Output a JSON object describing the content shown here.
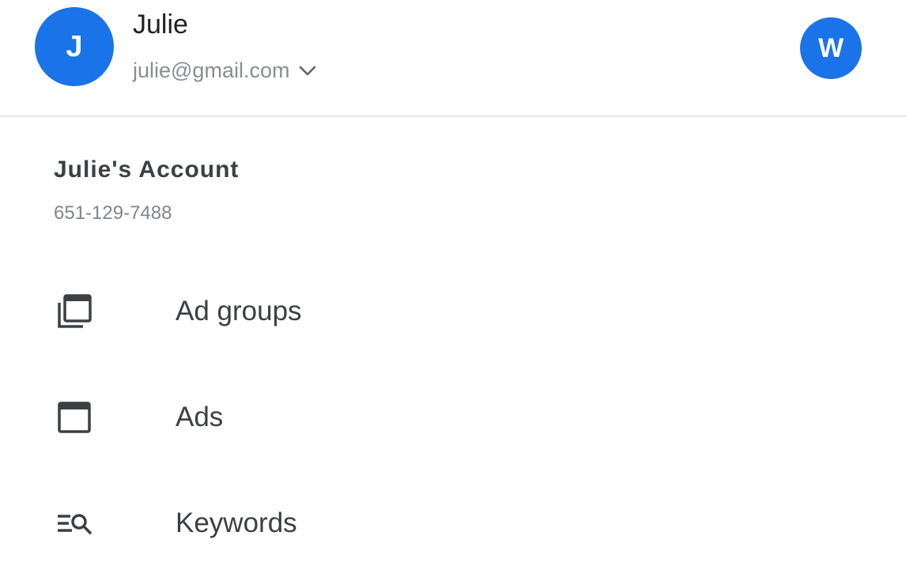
{
  "header": {
    "user_initial": "J",
    "user_name": "Julie",
    "user_email": "julie@gmail.com",
    "secondary_initial": "W",
    "accent_color": "#1a73e8"
  },
  "account": {
    "name": "Julie's Account",
    "id": "651-129-7488"
  },
  "nav": {
    "items": [
      {
        "label": "Ad groups",
        "icon": "ad-groups-icon"
      },
      {
        "label": "Ads",
        "icon": "ads-icon"
      },
      {
        "label": "Keywords",
        "icon": "keywords-icon"
      }
    ]
  }
}
